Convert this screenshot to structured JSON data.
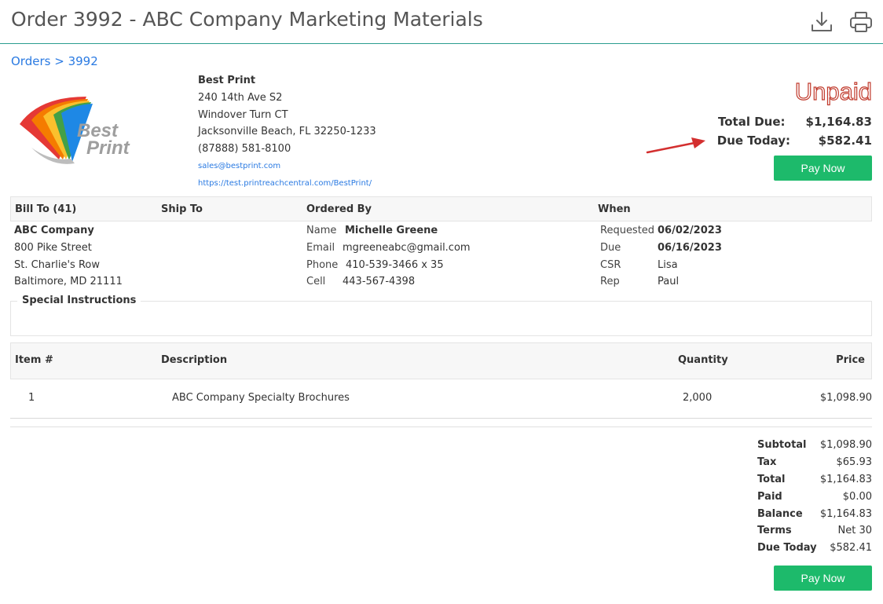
{
  "header": {
    "title": "Order 3992 - ABC Company Marketing Materials",
    "download_icon": "download-icon",
    "print_icon": "printer-icon"
  },
  "breadcrumb": {
    "parent": "Orders",
    "separator": ">",
    "current": "3992"
  },
  "logo": {
    "line1": "Best",
    "line2": "Print",
    "colors": [
      "#e53935",
      "#f57c00",
      "#fbc02d",
      "#43a047",
      "#1e88e5"
    ]
  },
  "company": {
    "name": "Best Print",
    "address1": "240 14th Ave S2",
    "address2": "Windover Turn CT",
    "city_line": "Jacksonville Beach, FL 32250-1233",
    "phone": "(87888) 581-8100",
    "email": "sales@bestprint.com",
    "website": "https://test.printreachcentral.com/BestPrint/"
  },
  "status": {
    "label": "Unpaid",
    "color": "#c0392b",
    "total_due_label": "Total Due:",
    "total_due": "$1,164.83",
    "due_today_label": "Due Today:",
    "due_today": "$582.41"
  },
  "pay_button": "Pay Now",
  "info_headers": {
    "bill_to": "Bill To (41)",
    "ship_to": "Ship To",
    "ordered_by": "Ordered By",
    "when": "When"
  },
  "bill_to": {
    "company": "ABC Company",
    "street": "800 Pike Street",
    "street2": "St. Charlie's Row",
    "city_line": "Baltimore, MD 21111"
  },
  "ordered_by": {
    "name_label": "Name",
    "name": "Michelle Greene",
    "email_label": "Email",
    "email": "mgreeneabc@gmail.com",
    "phone_label": "Phone",
    "phone": "410-539-3466 x 35",
    "cell_label": "Cell",
    "cell": "443-567-4398"
  },
  "when": {
    "requested_label": "Requested",
    "requested": "06/02/2023",
    "due_label": "Due",
    "due": "06/16/2023",
    "csr_label": "CSR",
    "csr": "Lisa",
    "rep_label": "Rep",
    "rep": "Paul"
  },
  "special_instructions": {
    "title": "Special Instructions",
    "text": ""
  },
  "items": {
    "columns": [
      "Item #",
      "Description",
      "Quantity",
      "Price"
    ],
    "rows": [
      {
        "item": "1",
        "description": "ABC Company Specialty Brochures",
        "quantity": "2,000",
        "price": "$1,098.90"
      }
    ]
  },
  "summary": [
    {
      "label": "Subtotal",
      "value": "$1,098.90"
    },
    {
      "label": "Tax",
      "value": "$65.93"
    },
    {
      "label": "Total",
      "value": "$1,164.83"
    },
    {
      "label": "Paid",
      "value": "$0.00"
    },
    {
      "label": "Balance",
      "value": "$1,164.83"
    },
    {
      "label": "Terms",
      "value": "Net 30"
    },
    {
      "label": "Due Today",
      "value": "$582.41"
    }
  ],
  "colors": {
    "accent": "#2a9d8f",
    "link": "#2a7ae2",
    "button": "#1dba6b",
    "arrow": "#d32f2f"
  }
}
